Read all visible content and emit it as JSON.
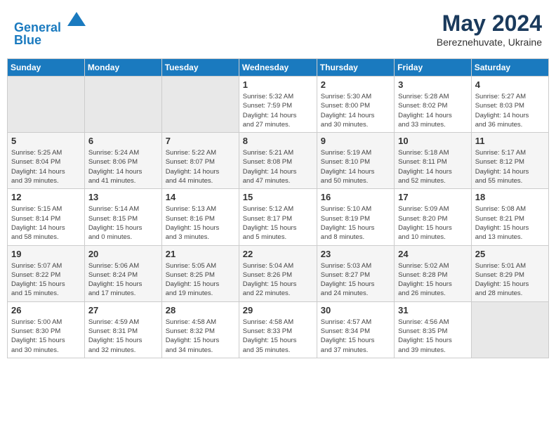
{
  "header": {
    "logo_line1": "General",
    "logo_line2": "Blue",
    "month_year": "May 2024",
    "location": "Bereznehuvate, Ukraine"
  },
  "weekdays": [
    "Sunday",
    "Monday",
    "Tuesday",
    "Wednesday",
    "Thursday",
    "Friday",
    "Saturday"
  ],
  "weeks": [
    [
      {
        "day": "",
        "info": ""
      },
      {
        "day": "",
        "info": ""
      },
      {
        "day": "",
        "info": ""
      },
      {
        "day": "1",
        "info": "Sunrise: 5:32 AM\nSunset: 7:59 PM\nDaylight: 14 hours\nand 27 minutes."
      },
      {
        "day": "2",
        "info": "Sunrise: 5:30 AM\nSunset: 8:00 PM\nDaylight: 14 hours\nand 30 minutes."
      },
      {
        "day": "3",
        "info": "Sunrise: 5:28 AM\nSunset: 8:02 PM\nDaylight: 14 hours\nand 33 minutes."
      },
      {
        "day": "4",
        "info": "Sunrise: 5:27 AM\nSunset: 8:03 PM\nDaylight: 14 hours\nand 36 minutes."
      }
    ],
    [
      {
        "day": "5",
        "info": "Sunrise: 5:25 AM\nSunset: 8:04 PM\nDaylight: 14 hours\nand 39 minutes."
      },
      {
        "day": "6",
        "info": "Sunrise: 5:24 AM\nSunset: 8:06 PM\nDaylight: 14 hours\nand 41 minutes."
      },
      {
        "day": "7",
        "info": "Sunrise: 5:22 AM\nSunset: 8:07 PM\nDaylight: 14 hours\nand 44 minutes."
      },
      {
        "day": "8",
        "info": "Sunrise: 5:21 AM\nSunset: 8:08 PM\nDaylight: 14 hours\nand 47 minutes."
      },
      {
        "day": "9",
        "info": "Sunrise: 5:19 AM\nSunset: 8:10 PM\nDaylight: 14 hours\nand 50 minutes."
      },
      {
        "day": "10",
        "info": "Sunrise: 5:18 AM\nSunset: 8:11 PM\nDaylight: 14 hours\nand 52 minutes."
      },
      {
        "day": "11",
        "info": "Sunrise: 5:17 AM\nSunset: 8:12 PM\nDaylight: 14 hours\nand 55 minutes."
      }
    ],
    [
      {
        "day": "12",
        "info": "Sunrise: 5:15 AM\nSunset: 8:14 PM\nDaylight: 14 hours\nand 58 minutes."
      },
      {
        "day": "13",
        "info": "Sunrise: 5:14 AM\nSunset: 8:15 PM\nDaylight: 15 hours\nand 0 minutes."
      },
      {
        "day": "14",
        "info": "Sunrise: 5:13 AM\nSunset: 8:16 PM\nDaylight: 15 hours\nand 3 minutes."
      },
      {
        "day": "15",
        "info": "Sunrise: 5:12 AM\nSunset: 8:17 PM\nDaylight: 15 hours\nand 5 minutes."
      },
      {
        "day": "16",
        "info": "Sunrise: 5:10 AM\nSunset: 8:19 PM\nDaylight: 15 hours\nand 8 minutes."
      },
      {
        "day": "17",
        "info": "Sunrise: 5:09 AM\nSunset: 8:20 PM\nDaylight: 15 hours\nand 10 minutes."
      },
      {
        "day": "18",
        "info": "Sunrise: 5:08 AM\nSunset: 8:21 PM\nDaylight: 15 hours\nand 13 minutes."
      }
    ],
    [
      {
        "day": "19",
        "info": "Sunrise: 5:07 AM\nSunset: 8:22 PM\nDaylight: 15 hours\nand 15 minutes."
      },
      {
        "day": "20",
        "info": "Sunrise: 5:06 AM\nSunset: 8:24 PM\nDaylight: 15 hours\nand 17 minutes."
      },
      {
        "day": "21",
        "info": "Sunrise: 5:05 AM\nSunset: 8:25 PM\nDaylight: 15 hours\nand 19 minutes."
      },
      {
        "day": "22",
        "info": "Sunrise: 5:04 AM\nSunset: 8:26 PM\nDaylight: 15 hours\nand 22 minutes."
      },
      {
        "day": "23",
        "info": "Sunrise: 5:03 AM\nSunset: 8:27 PM\nDaylight: 15 hours\nand 24 minutes."
      },
      {
        "day": "24",
        "info": "Sunrise: 5:02 AM\nSunset: 8:28 PM\nDaylight: 15 hours\nand 26 minutes."
      },
      {
        "day": "25",
        "info": "Sunrise: 5:01 AM\nSunset: 8:29 PM\nDaylight: 15 hours\nand 28 minutes."
      }
    ],
    [
      {
        "day": "26",
        "info": "Sunrise: 5:00 AM\nSunset: 8:30 PM\nDaylight: 15 hours\nand 30 minutes."
      },
      {
        "day": "27",
        "info": "Sunrise: 4:59 AM\nSunset: 8:31 PM\nDaylight: 15 hours\nand 32 minutes."
      },
      {
        "day": "28",
        "info": "Sunrise: 4:58 AM\nSunset: 8:32 PM\nDaylight: 15 hours\nand 34 minutes."
      },
      {
        "day": "29",
        "info": "Sunrise: 4:58 AM\nSunset: 8:33 PM\nDaylight: 15 hours\nand 35 minutes."
      },
      {
        "day": "30",
        "info": "Sunrise: 4:57 AM\nSunset: 8:34 PM\nDaylight: 15 hours\nand 37 minutes."
      },
      {
        "day": "31",
        "info": "Sunrise: 4:56 AM\nSunset: 8:35 PM\nDaylight: 15 hours\nand 39 minutes."
      },
      {
        "day": "",
        "info": ""
      }
    ]
  ]
}
